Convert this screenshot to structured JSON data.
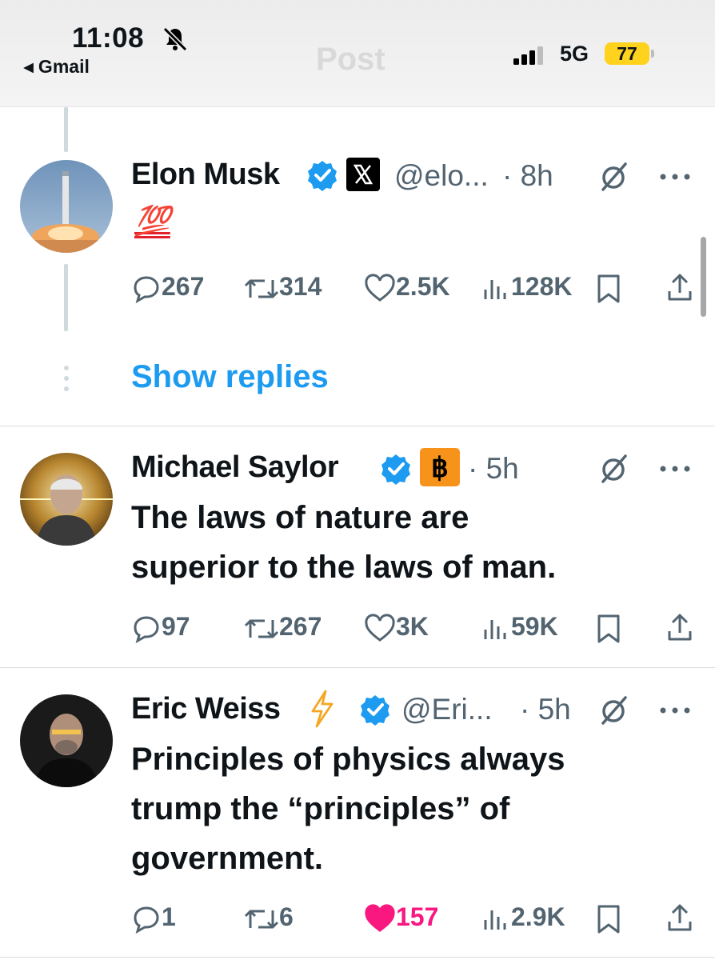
{
  "status_bar": {
    "time": "11:08",
    "back_label": "◂ Gmail",
    "faded_title": "Post",
    "network": "5G",
    "battery": "77"
  },
  "posts": [
    {
      "name": "Elon Musk",
      "handle": "@elo...",
      "time": "· 8h",
      "text": "💯",
      "replies": "267",
      "reposts": "314",
      "likes": "2.5K",
      "views": "128K"
    },
    {
      "name": "Michael Saylor",
      "time": "· 5h",
      "text_lines": [
        "The laws of nature are",
        "superior to the laws of man."
      ],
      "replies": "97",
      "reposts": "267",
      "likes": "3K",
      "views": "59K"
    },
    {
      "name": "Eric Weiss",
      "handle": "@Eri...",
      "time": "· 5h",
      "text_lines": [
        "Principles of physics always",
        "trump the “principles” of",
        "government."
      ],
      "replies": "1",
      "reposts": "6",
      "likes": "157",
      "views": "2.9K"
    }
  ],
  "show_replies_label": "Show replies",
  "colors": {
    "accent": "#1d9bf0",
    "like_active": "#f91880",
    "text": "#0f1419",
    "muted": "#536471",
    "bitcoin": "#f7931a"
  }
}
